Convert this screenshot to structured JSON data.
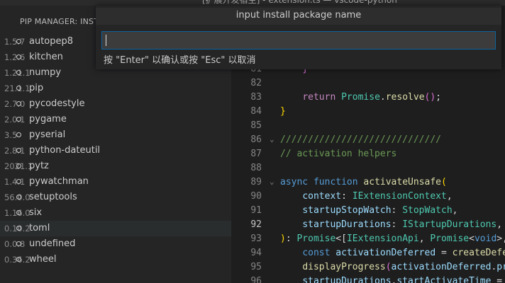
{
  "window": {
    "title": "[扩展开发宿主] - extension.ts — vscode-python"
  },
  "sidebar": {
    "title": "PIP MANAGER: INST",
    "packages": [
      {
        "name": "autopep8",
        "version": "1.5.7"
      },
      {
        "name": "kitchen",
        "version": "1.2.6"
      },
      {
        "name": "numpy",
        "version": "1.21.1"
      },
      {
        "name": "pip",
        "version": "21.1.1"
      },
      {
        "name": "pycodestyle",
        "version": "2.7.0"
      },
      {
        "name": "pygame",
        "version": "2.0.1"
      },
      {
        "name": "pyserial",
        "version": "3.5"
      },
      {
        "name": "python-dateutil",
        "version": "2.8.1"
      },
      {
        "name": "pytz",
        "version": "2021.1"
      },
      {
        "name": "pywatchman",
        "version": "1.4.1"
      },
      {
        "name": "setuptools",
        "version": "56.0.0"
      },
      {
        "name": "six",
        "version": "1.16.0"
      },
      {
        "name": "toml",
        "version": "0.10.2",
        "selected": true
      },
      {
        "name": "undefined",
        "version": "0.0.8"
      },
      {
        "name": "wheel",
        "version": "0.36.2"
      }
    ]
  },
  "editor": {
    "active_line": "92",
    "lines": [
      {
        "num": "81",
        "fold": "",
        "tokens": [
          [
            "",
            "    "
          ],
          [
            "br2",
            "}"
          ]
        ]
      },
      {
        "num": "82",
        "fold": "",
        "tokens": []
      },
      {
        "num": "83",
        "fold": "",
        "tokens": [
          [
            "",
            "    "
          ],
          [
            "kw2",
            "return"
          ],
          [
            "",
            " "
          ],
          [
            "ty",
            "Promise"
          ],
          [
            "",
            "."
          ],
          [
            "fn",
            "resolve"
          ],
          [
            "br2",
            "()"
          ],
          [
            "",
            ";"
          ]
        ]
      },
      {
        "num": "84",
        "fold": "",
        "tokens": [
          [
            "br",
            "}"
          ]
        ]
      },
      {
        "num": "85",
        "fold": "",
        "tokens": []
      },
      {
        "num": "86",
        "fold": "⌄",
        "tokens": [
          [
            "cm",
            "/////////////////////////////"
          ]
        ]
      },
      {
        "num": "87",
        "fold": "",
        "tokens": [
          [
            "cm",
            "// activation helpers"
          ]
        ]
      },
      {
        "num": "88",
        "fold": "",
        "tokens": []
      },
      {
        "num": "89",
        "fold": "⌄",
        "tokens": [
          [
            "kw",
            "async"
          ],
          [
            "",
            " "
          ],
          [
            "kw",
            "function"
          ],
          [
            "",
            " "
          ],
          [
            "fn",
            "activateUnsafe"
          ],
          [
            "br",
            "("
          ]
        ]
      },
      {
        "num": "90",
        "fold": "",
        "tokens": [
          [
            "",
            "    "
          ],
          [
            "vb",
            "context"
          ],
          [
            "",
            ": "
          ],
          [
            "ty",
            "IExtensionContext"
          ],
          [
            "",
            ","
          ]
        ]
      },
      {
        "num": "91",
        "fold": "",
        "tokens": [
          [
            "",
            "    "
          ],
          [
            "vb",
            "startupStopWatch"
          ],
          [
            "",
            ": "
          ],
          [
            "ty",
            "StopWatch"
          ],
          [
            "",
            ","
          ]
        ]
      },
      {
        "num": "92",
        "fold": "",
        "tokens": [
          [
            "",
            "    "
          ],
          [
            "vb",
            "startupDurations"
          ],
          [
            "",
            ": "
          ],
          [
            "ty",
            "IStartupDurations"
          ],
          [
            "",
            ","
          ]
        ]
      },
      {
        "num": "93",
        "fold": "",
        "tokens": [
          [
            "br",
            ")"
          ],
          [
            "",
            ": "
          ],
          [
            "ty",
            "Promise"
          ],
          [
            "",
            "<["
          ],
          [
            "ty",
            "IExtensionApi"
          ],
          [
            "",
            ", "
          ],
          [
            "ty",
            "Promise"
          ],
          [
            "",
            "<"
          ],
          [
            "kw",
            "void"
          ],
          [
            "",
            ">,"
          ]
        ]
      },
      {
        "num": "94",
        "fold": "",
        "tokens": [
          [
            "",
            "    "
          ],
          [
            "kw",
            "const"
          ],
          [
            "",
            " "
          ],
          [
            "vb",
            "activationDeferred"
          ],
          [
            "",
            " = "
          ],
          [
            "fn",
            "createDefe"
          ]
        ]
      },
      {
        "num": "95",
        "fold": "",
        "tokens": [
          [
            "",
            "    "
          ],
          [
            "fn",
            "displayProgress"
          ],
          [
            "br2",
            "("
          ],
          [
            "vb",
            "activationDeferred"
          ],
          [
            "",
            "."
          ],
          [
            "vb",
            "pr"
          ]
        ]
      },
      {
        "num": "96",
        "fold": "",
        "tokens": [
          [
            "",
            "    "
          ],
          [
            "vb",
            "startupDurations"
          ],
          [
            "",
            "."
          ],
          [
            "vb",
            "startActivateTime"
          ],
          [
            "",
            " ="
          ]
        ]
      }
    ]
  },
  "quick_input": {
    "title": "input install package name",
    "value": "",
    "hint": "按 \"Enter\" 以确认或按 \"Esc\" 以取消"
  }
}
